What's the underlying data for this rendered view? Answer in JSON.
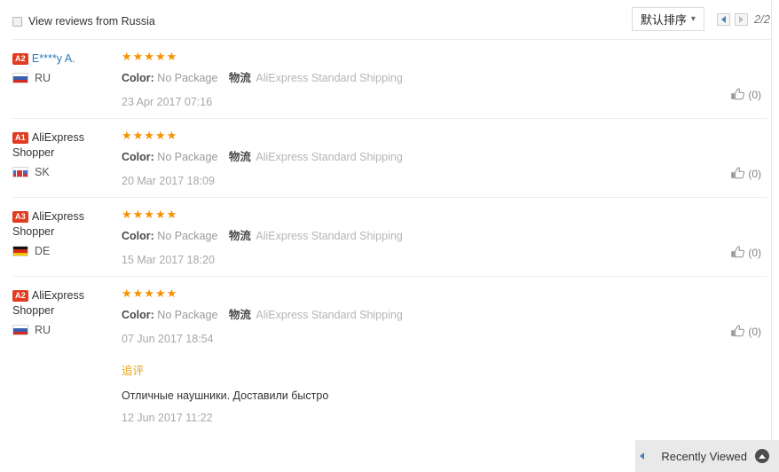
{
  "header": {
    "filter_checkbox_label": "View reviews from Russia",
    "sort_label": "默认排序",
    "sort_caret": "chevron-down-icon",
    "page_indicator": "2/2"
  },
  "reviews": [
    {
      "badge": "A2",
      "username": "E****y A.",
      "username_is_link": true,
      "country_code": "RU",
      "flag": "flag-ru",
      "stars": "★★★★★",
      "color_label": "Color:",
      "color_value": "No Package",
      "logistics_label": "物流",
      "shipping": "AliExpress Standard Shipping",
      "date": "23 Apr 2017 07:16",
      "helpful_count": "(0)"
    },
    {
      "badge": "A1",
      "username": "AliExpress Shopper",
      "username_is_link": false,
      "country_code": "SK",
      "flag": "flag-sk",
      "stars": "★★★★★",
      "color_label": "Color:",
      "color_value": "No Package",
      "logistics_label": "物流",
      "shipping": "AliExpress Standard Shipping",
      "date": "20 Mar 2017 18:09",
      "helpful_count": "(0)"
    },
    {
      "badge": "A3",
      "username": "AliExpress Shopper",
      "username_is_link": false,
      "country_code": "DE",
      "flag": "flag-de",
      "stars": "★★★★★",
      "color_label": "Color:",
      "color_value": "No Package",
      "logistics_label": "物流",
      "shipping": "AliExpress Standard Shipping",
      "date": "15 Mar 2017 18:20",
      "helpful_count": "(0)"
    },
    {
      "badge": "A2",
      "username": "AliExpress Shopper",
      "username_is_link": false,
      "country_code": "RU",
      "flag": "flag-ru",
      "stars": "★★★★★",
      "color_label": "Color:",
      "color_value": "No Package",
      "logistics_label": "物流",
      "shipping": "AliExpress Standard Shipping",
      "date": "07 Jun 2017 18:54",
      "helpful_count": "(0)",
      "followup": {
        "title": "追评",
        "text": "Отличные наушники. Доставили быстро",
        "date": "12 Jun 2017 11:22"
      }
    }
  ],
  "recently_viewed": {
    "label": "Recently Viewed",
    "collapse_icon": "chevron-up-icon",
    "expand_tab_icon": "chevron-left-icon"
  },
  "colors": {
    "star": "#f89000",
    "badge": "#e03c20",
    "link": "#2a7ac0",
    "followup_title": "#e8a317",
    "muted": "#a8a8a8"
  }
}
